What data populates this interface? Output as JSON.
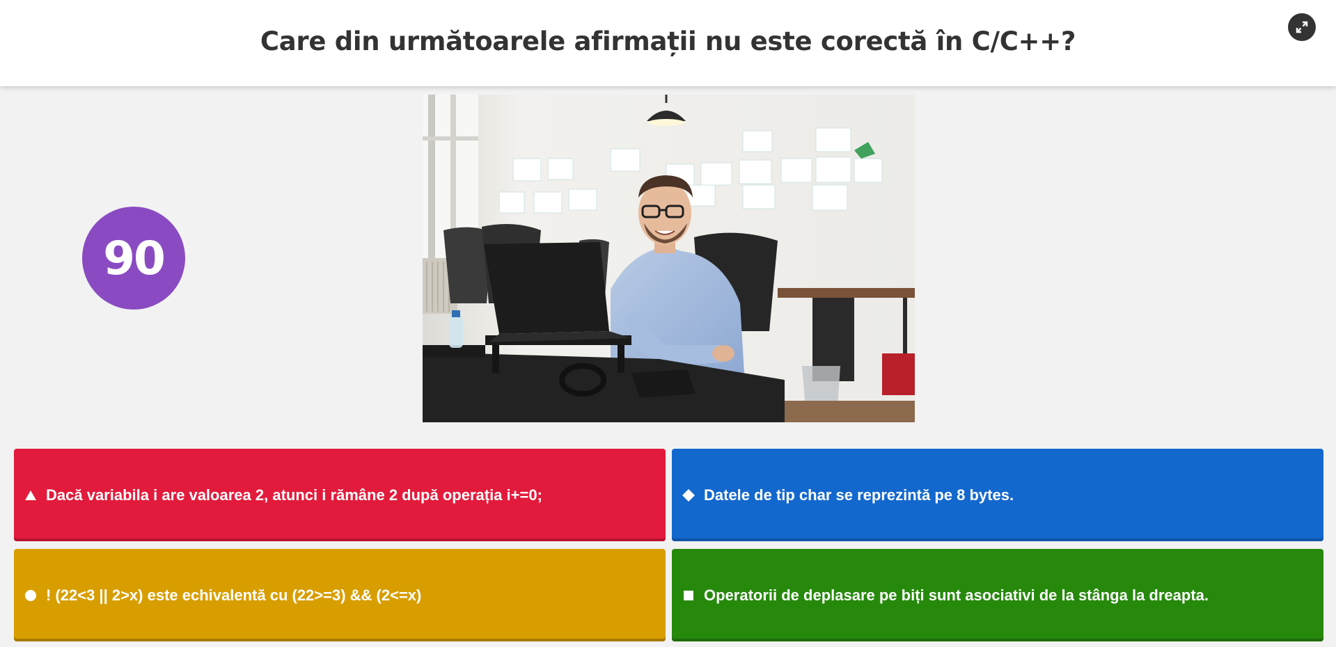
{
  "question": {
    "text": "Care din următoarele afirmații nu este corectă în C/C++?"
  },
  "fullscreen": {
    "icon": "fullscreen-icon"
  },
  "timer": {
    "value": "90",
    "color": "#8a4bc2"
  },
  "media": {
    "icon": "photo-man-at-laptop"
  },
  "answers": [
    {
      "shape": "triangle-icon",
      "text": "Dacă variabila i are valoarea 2, atunci i rămâne 2 după operația i+=0;",
      "color": "#e21b3c",
      "shadow": "#b7142f"
    },
    {
      "shape": "diamond-icon",
      "text": "Datele de tip char se reprezintă pe 8 bytes.",
      "color": "#1368ce",
      "shadow": "#0f56a9"
    },
    {
      "shape": "circle-icon",
      "text": "! (22<3 || 2>x) este echivalentă cu (22>=3) && (2<=x)",
      "color": "#d89e00",
      "shadow": "#a97b00"
    },
    {
      "shape": "square-icon",
      "text": "Operatorii de deplasare pe biți sunt asociativi de la stânga la dreapta.",
      "color": "#26890c",
      "shadow": "#1e6d09"
    }
  ]
}
